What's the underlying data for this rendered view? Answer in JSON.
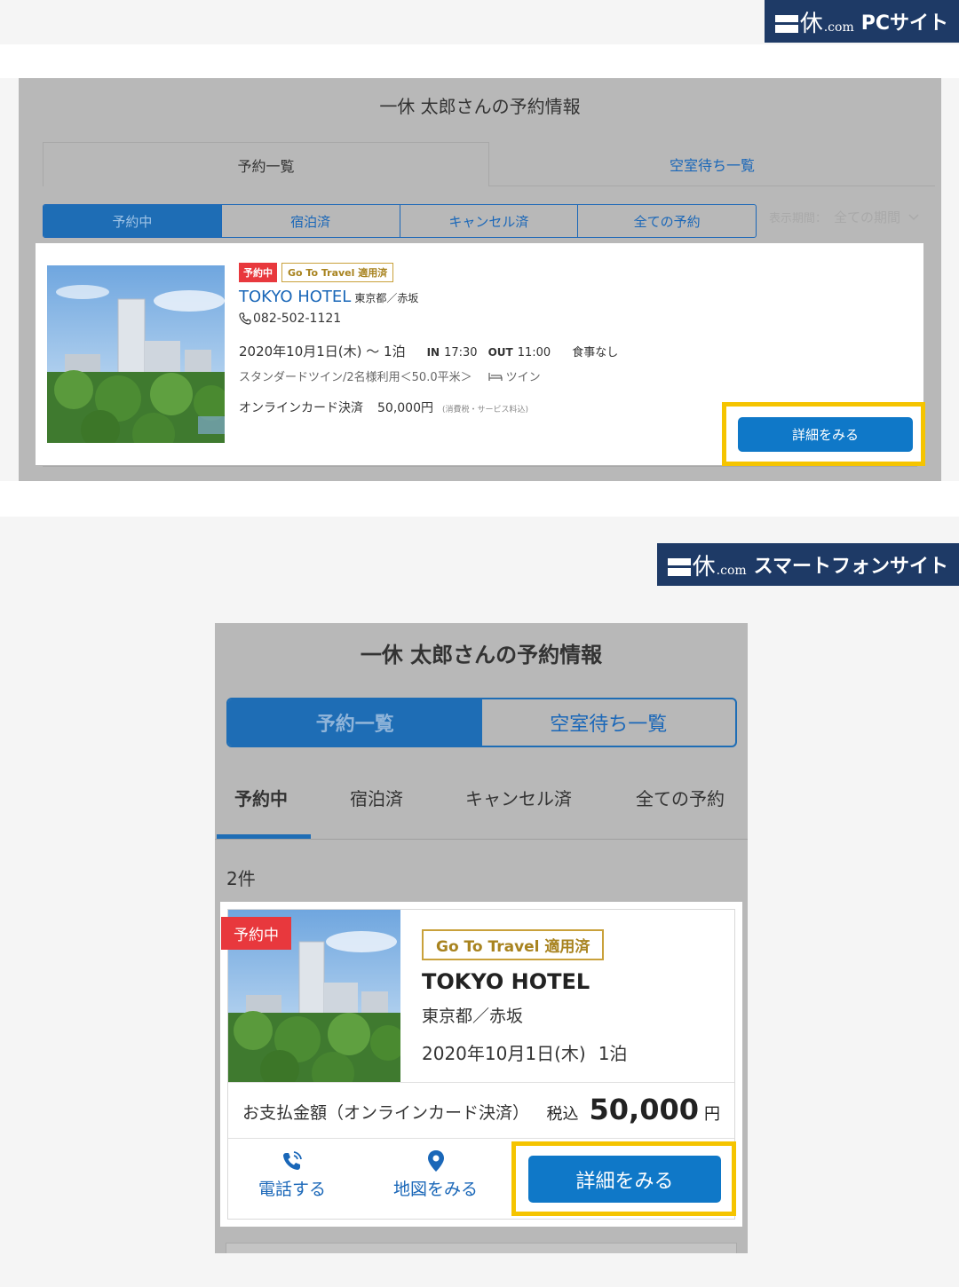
{
  "pc_label": {
    "kanji": "休",
    "com": ".com",
    "text": "PCサイト"
  },
  "sp_label": {
    "kanji": "休",
    "com": ".com",
    "text": "スマートフォンサイト"
  },
  "pc": {
    "title": "一休 太郎さんの予約情報",
    "tabs": [
      "予約一覧",
      "空室待ち一覧"
    ],
    "segments": [
      "予約中",
      "宿泊済",
      "キャンセル済",
      "全ての予約"
    ],
    "period_label": "表示期間：",
    "period_value": "全ての期間",
    "card": {
      "badge_status": "予約中",
      "badge_goto": "Go To Travel 適用済",
      "hotel_name": "TOKYO HOTEL",
      "hotel_area": "東京都／赤坂",
      "phone": "082-502-1121",
      "date": "2020年10月1日(木) ～ 1泊",
      "in_label": "IN",
      "in_time": "17:30",
      "out_label": "OUT",
      "out_time": "11:00",
      "meal": "食事なし",
      "room": "スタンダードツイン/2名様利用＜50.0平米＞",
      "bed": "ツイン",
      "pay_method": "オンラインカード決済",
      "amount": "50,000円",
      "tax_note": "(消費税・サービス料込)",
      "detail_button": "詳細をみる"
    }
  },
  "sp": {
    "title": "一休 太郎さんの予約情報",
    "toggle": [
      "予約一覧",
      "空室待ち一覧"
    ],
    "subtabs": [
      "予約中",
      "宿泊済",
      "キャンセル済",
      "全ての予約"
    ],
    "count": "2件",
    "card": {
      "status_tag": "予約中",
      "goto": "Go To Travel 適用済",
      "hotel_name": "TOKYO HOTEL",
      "hotel_area": "東京都／赤坂",
      "date": "2020年10月1日(木)",
      "nights": "1泊",
      "pay_label": "お支払金額（オンラインカード決済）",
      "tax_label": "税込",
      "amount": "50,000",
      "yen": "円",
      "call_label": "電話する",
      "map_label": "地図をみる",
      "detail_button": "詳細をみる"
    }
  },
  "colors": {
    "navy": "#1e3a66",
    "blue": "#0f78c8",
    "highlight": "#f5c400",
    "red": "#e8383d",
    "gold": "#c9a13b"
  }
}
